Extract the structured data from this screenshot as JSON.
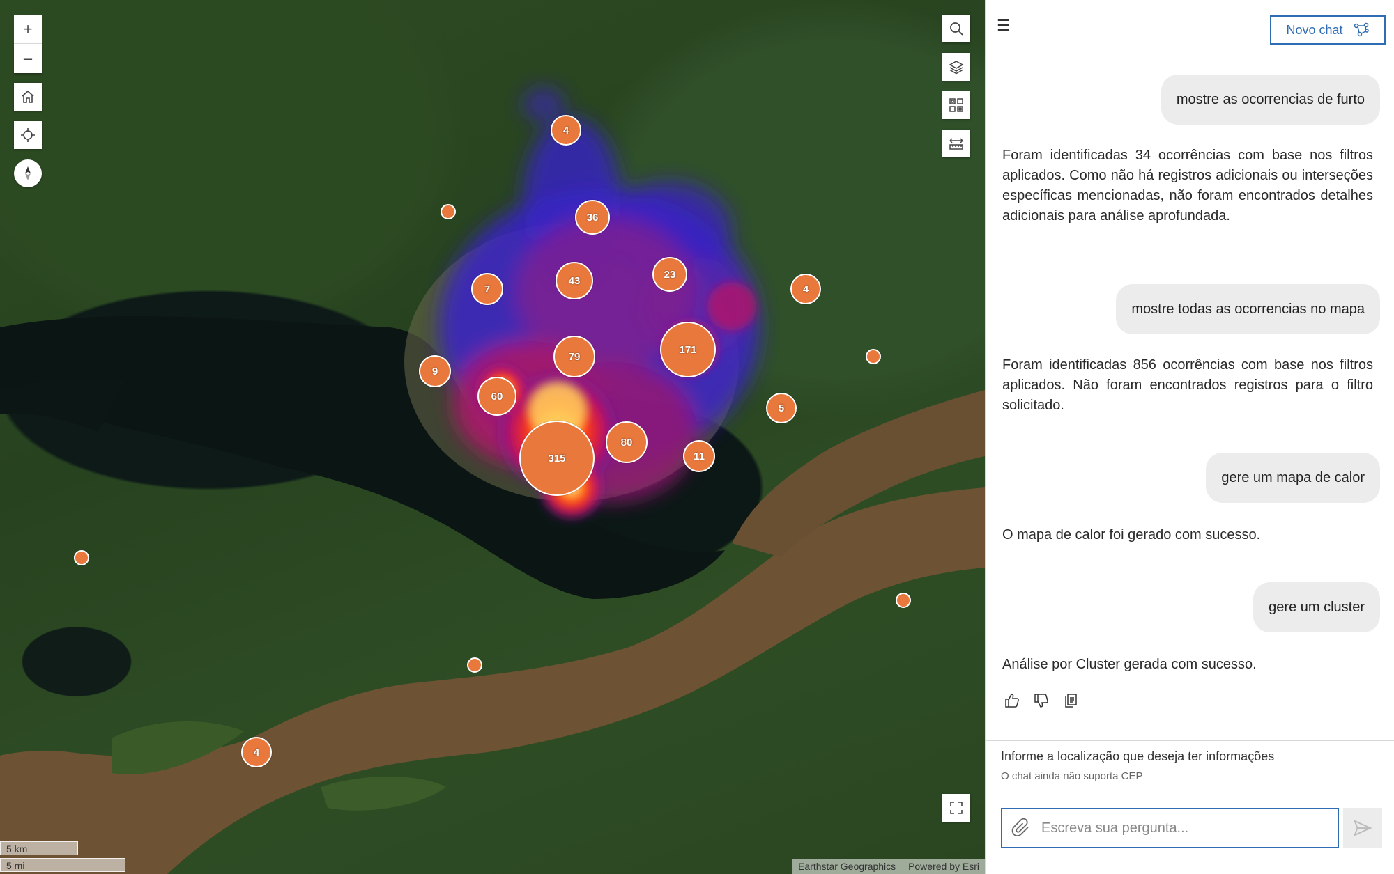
{
  "map": {
    "zoom_in": "+",
    "zoom_out": "–",
    "clusters": [
      {
        "label": "4"
      },
      {
        "label": "36"
      },
      {
        "label": "7"
      },
      {
        "label": "43"
      },
      {
        "label": "23"
      },
      {
        "label": "4"
      },
      {
        "label": "171"
      },
      {
        "label": "79"
      },
      {
        "label": "9"
      },
      {
        "label": "60"
      },
      {
        "label": "5"
      },
      {
        "label": "80"
      },
      {
        "label": "11"
      },
      {
        "label": "315"
      },
      {
        "label": "4"
      }
    ],
    "scale": {
      "km": "5 km",
      "mi": "5 mi"
    },
    "attribution": {
      "source": "Earthstar Geographics",
      "powered": "Powered by Esri"
    },
    "colors": {
      "cluster": "#e8783c"
    }
  },
  "panel": {
    "new_chat_label": "Novo chat",
    "messages": [
      {
        "role": "user",
        "text": "mostre as ocorrencias de furto"
      },
      {
        "role": "assistant",
        "text": "Foram identificadas 34 ocorrências com base nos filtros aplicados. Como não há registros adicionais ou interseções específicas mencionadas, não foram encontrados detalhes adicionais para análise aprofundada."
      },
      {
        "role": "user",
        "text": "mostre todas as ocorrencias no mapa"
      },
      {
        "role": "assistant",
        "text": "Foram identificadas 856 ocorrências com base nos filtros aplicados. Não foram encontrados registros para o filtro solicitado."
      },
      {
        "role": "user",
        "text": "gere um mapa de calor"
      },
      {
        "role": "assistant",
        "text": "O mapa de calor foi gerado com sucesso."
      },
      {
        "role": "user",
        "text": "gere um cluster"
      },
      {
        "role": "assistant",
        "text": "Análise por Cluster gerada com sucesso."
      }
    ],
    "hint": "Informe a localização que deseja ter informações",
    "hint_sub": "O chat ainda não suporta CEP",
    "input_placeholder": "Escreva sua pergunta...",
    "accent": "#2e6db4"
  }
}
